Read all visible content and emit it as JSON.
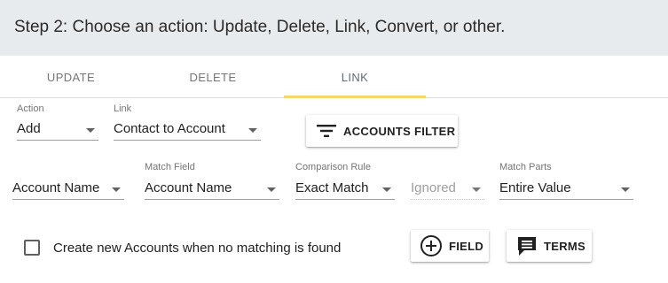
{
  "header": {
    "title": "Step 2: Choose an action: Update, Delete, Link, Convert, or other."
  },
  "tabs": [
    {
      "label": "UPDATE",
      "active": false
    },
    {
      "label": "DELETE",
      "active": false
    },
    {
      "label": "LINK",
      "active": true
    }
  ],
  "colors": {
    "tab_indicator": "#f5d66b",
    "header_bg": "#e8ebee"
  },
  "row1": {
    "action": {
      "label": "Action",
      "value": "Add"
    },
    "link": {
      "label": "Link",
      "value": "Contact to Account"
    },
    "accounts_filter_button": {
      "label": "ACCOUNTS FILTER",
      "icon": "filter-list-icon"
    }
  },
  "row2": {
    "source_field": {
      "value": "Account Name"
    },
    "match_field": {
      "label": "Match Field",
      "value": "Account Name"
    },
    "comparison_rule": {
      "label": "Comparison Rule",
      "value": "Exact Match"
    },
    "case_option": {
      "value": "Ignored",
      "disabled": true
    },
    "match_parts": {
      "label": "Match Parts",
      "value": "Entire Value"
    }
  },
  "row3": {
    "create_new_checkbox": {
      "label": "Create new Accounts when no matching is found",
      "checked": false
    },
    "field_button": {
      "label": "FIELD",
      "icon": "add-circle-icon"
    },
    "terms_button": {
      "label": "TERMS",
      "icon": "comment-icon"
    }
  }
}
